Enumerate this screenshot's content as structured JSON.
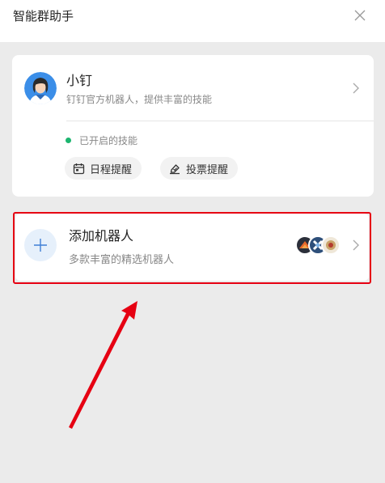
{
  "header": {
    "title": "智能群助手"
  },
  "bot": {
    "name": "小钉",
    "desc": "钉钉官方机器人，提供丰富的技能",
    "status": "已开启的技能",
    "skills": [
      {
        "label": "日程提醒",
        "icon": "calendar-icon"
      },
      {
        "label": "投票提醒",
        "icon": "vote-icon"
      }
    ]
  },
  "add_robot": {
    "title": "添加机器人",
    "subtitle": "多款丰富的精选机器人"
  },
  "colors": {
    "background": "#ebebeb",
    "status_green": "#1cb56f",
    "highlight_red": "#e60012",
    "plus_blue": "#3f7fd6"
  }
}
